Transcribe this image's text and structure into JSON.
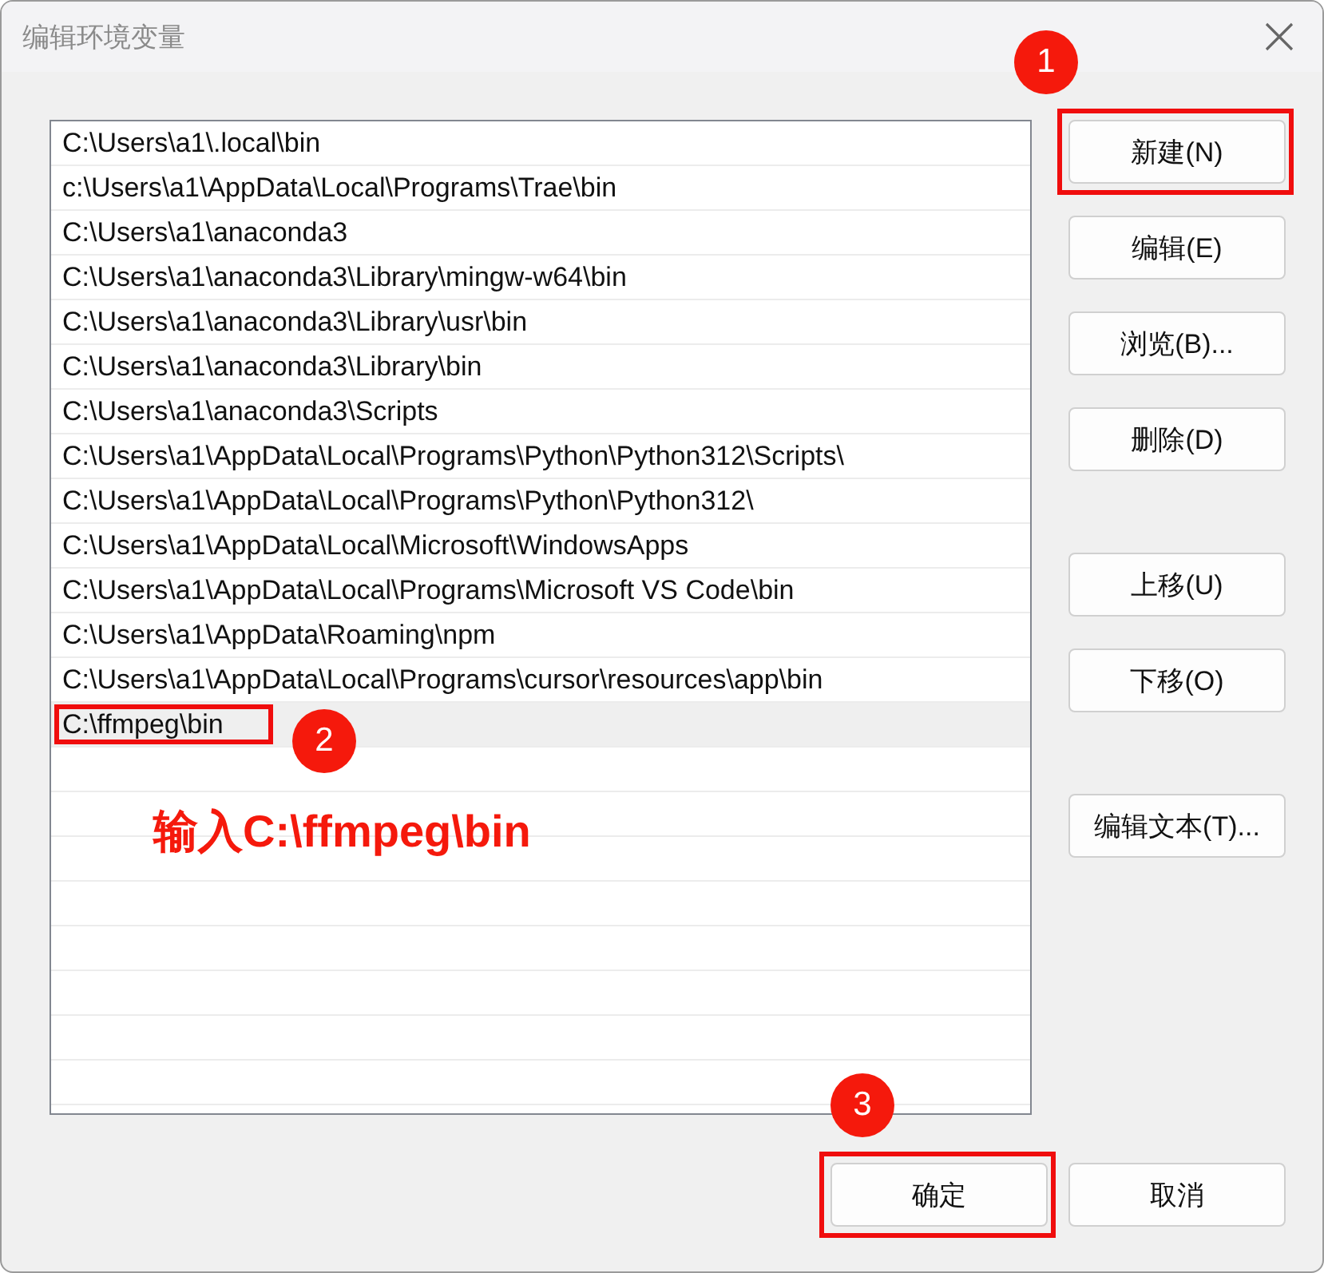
{
  "window": {
    "title": "编辑环境变量"
  },
  "entries": [
    {
      "text": "C:\\Users\\a1\\.local\\bin",
      "selected": false,
      "highlighted": false
    },
    {
      "text": "c:\\Users\\a1\\AppData\\Local\\Programs\\Trae\\bin",
      "selected": false,
      "highlighted": false
    },
    {
      "text": "C:\\Users\\a1\\anaconda3",
      "selected": false,
      "highlighted": false
    },
    {
      "text": "C:\\Users\\a1\\anaconda3\\Library\\mingw-w64\\bin",
      "selected": false,
      "highlighted": false
    },
    {
      "text": "C:\\Users\\a1\\anaconda3\\Library\\usr\\bin",
      "selected": false,
      "highlighted": false
    },
    {
      "text": "C:\\Users\\a1\\anaconda3\\Library\\bin",
      "selected": false,
      "highlighted": false
    },
    {
      "text": "C:\\Users\\a1\\anaconda3\\Scripts",
      "selected": false,
      "highlighted": false
    },
    {
      "text": "C:\\Users\\a1\\AppData\\Local\\Programs\\Python\\Python312\\Scripts\\",
      "selected": false,
      "highlighted": false
    },
    {
      "text": "C:\\Users\\a1\\AppData\\Local\\Programs\\Python\\Python312\\",
      "selected": false,
      "highlighted": false
    },
    {
      "text": "C:\\Users\\a1\\AppData\\Local\\Microsoft\\WindowsApps",
      "selected": false,
      "highlighted": false
    },
    {
      "text": "C:\\Users\\a1\\AppData\\Local\\Programs\\Microsoft VS Code\\bin",
      "selected": false,
      "highlighted": false
    },
    {
      "text": "C:\\Users\\a1\\AppData\\Roaming\\npm",
      "selected": false,
      "highlighted": false
    },
    {
      "text": "C:\\Users\\a1\\AppData\\Local\\Programs\\cursor\\resources\\app\\bin",
      "selected": false,
      "highlighted": false
    },
    {
      "text": "C:\\ffmpeg\\bin",
      "selected": true,
      "highlighted": true,
      "marker": "2"
    }
  ],
  "annotation_note": "输入C:\\ffmpeg\\bin",
  "side_button_groups": [
    [
      {
        "label": "新建(N)",
        "highlighted": true,
        "marker": "1"
      },
      {
        "label": "编辑(E)",
        "highlighted": false
      },
      {
        "label": "浏览(B)...",
        "highlighted": false
      },
      {
        "label": "删除(D)",
        "highlighted": false
      }
    ],
    [
      {
        "label": "上移(U)",
        "highlighted": false
      },
      {
        "label": "下移(O)",
        "highlighted": false
      }
    ],
    [
      {
        "label": "编辑文本(T)...",
        "highlighted": false
      }
    ]
  ],
  "footer_buttons": [
    {
      "label": "确定",
      "highlighted": true,
      "marker": "3"
    },
    {
      "label": "取消",
      "highlighted": false
    }
  ]
}
